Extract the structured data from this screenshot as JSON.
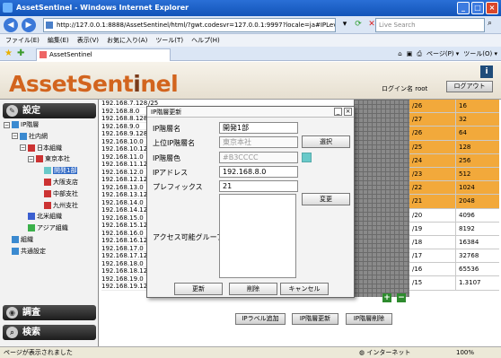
{
  "window": {
    "title": "AssetSentinel - Windows Internet Explorer",
    "btn_min": "_",
    "btn_max": "□",
    "btn_close": "×"
  },
  "browser": {
    "url": "http://127.0.0.1:8888/AssetSentinel/html/?gwt.codesvr=127.0.0.1:9997?locale=ja#IPLevel15",
    "search_placeholder": "Live Search",
    "menu": [
      "ファイル(E)",
      "編集(E)",
      "表示(V)",
      "お気に入り(A)",
      "ツール(T)",
      "ヘルプ(H)"
    ],
    "tab_label": "AssetSentinel",
    "toolbar_right": [
      "ページ(P) ▾",
      "ツール(O) ▾"
    ]
  },
  "app": {
    "logo_main": "AssetSent",
    "logo_i": "i",
    "logo_end": "nel",
    "login_label": "ログイン名 root",
    "logout_label": "ログアウト",
    "info_label": "i"
  },
  "sidebar": {
    "settings_label": "設定",
    "survey_label": "調査",
    "search_label": "検索",
    "tree": [
      {
        "label": "IP階層",
        "level": 0,
        "toggle": "⊟",
        "color": "#3b8ad0"
      },
      {
        "label": "社内網",
        "level": 1,
        "toggle": "⊟",
        "color": "#3b8ad0"
      },
      {
        "label": "日本組織",
        "level": 2,
        "toggle": "⊟",
        "color": "#cc3333"
      },
      {
        "label": "東京本社",
        "level": 3,
        "toggle": "⊟",
        "color": "#cc3333"
      },
      {
        "label": "開発1部",
        "level": 4,
        "toggle": "",
        "color": "#69c9c9",
        "selected": true
      },
      {
        "label": "大阪支店",
        "level": 4,
        "toggle": "",
        "color": "#cc3333"
      },
      {
        "label": "中部支社",
        "level": 4,
        "toggle": "",
        "color": "#cc3333"
      },
      {
        "label": "九州支社",
        "level": 4,
        "toggle": "",
        "color": "#cc3333"
      },
      {
        "label": "北米組織",
        "level": 2,
        "toggle": "",
        "color": "#3b5fd0"
      },
      {
        "label": "アジア組織",
        "level": 2,
        "toggle": "",
        "color": "#3bb04a"
      },
      {
        "label": "組織",
        "level": 0,
        "toggle": "",
        "color": "#3b8ad0"
      },
      {
        "label": "共通設定",
        "level": 0,
        "toggle": "",
        "color": "#3b8ad0"
      }
    ]
  },
  "iplist": [
    "192.168.7.128",
    "192.168.8.0",
    "192.168.8.128",
    "192.168.9.0",
    "192.168.9.128",
    "192.168.10.0",
    "192.168.10.128",
    "192.168.11.0",
    "192.168.11.128",
    "192.168.12.0",
    "192.168.12.128",
    "192.168.13.0",
    "192.168.13.128",
    "192.168.14.0",
    "192.168.14.128",
    "192.168.15.0",
    "192.168.15.128",
    "192.168.16.0",
    "192.168.16.128",
    "192.168.17.0",
    "192.168.17.128",
    "192.168.18.0",
    "192.168.18.128",
    "192.168.19.0",
    "192.168.19.128"
  ],
  "iplist_first_prefix": "/25",
  "sizes": [
    {
      "prefix": "/26",
      "count": "16",
      "highlight": true
    },
    {
      "prefix": "/27",
      "count": "32",
      "highlight": true
    },
    {
      "prefix": "/26",
      "count": "64",
      "highlight": true
    },
    {
      "prefix": "/25",
      "count": "128",
      "highlight": true
    },
    {
      "prefix": "/24",
      "count": "256",
      "highlight": true
    },
    {
      "prefix": "/23",
      "count": "512",
      "highlight": true
    },
    {
      "prefix": "/22",
      "count": "1024",
      "highlight": true
    },
    {
      "prefix": "/21",
      "count": "2048",
      "highlight": true
    },
    {
      "prefix": "/20",
      "count": "4096",
      "highlight": false
    },
    {
      "prefix": "/19",
      "count": "8192",
      "highlight": false
    },
    {
      "prefix": "/18",
      "count": "16384",
      "highlight": false
    },
    {
      "prefix": "/17",
      "count": "32768",
      "highlight": false
    },
    {
      "prefix": "/16",
      "count": "65536",
      "highlight": false
    },
    {
      "prefix": "/15",
      "count": "1.3107",
      "highlight": false
    }
  ],
  "actions": {
    "add_label": "IPラベル追加",
    "update_label": "IP階層更新",
    "delete_label": "IP階層削除",
    "plus": "+",
    "minus": "−"
  },
  "dialog": {
    "title": "IP階層更新",
    "name_label": "IP階層名",
    "name_value": "開発1部",
    "parent_label": "上位IP階層名",
    "parent_value": "東京本社",
    "select_label": "選択",
    "color_label": "IP階層色",
    "color_value": "#B3CCCC",
    "address_label": "IPアドレス",
    "address_value": "192.168.8.0",
    "prefix_label": "プレフィックス",
    "prefix_value": "21",
    "change_label": "変更",
    "access_label": "アクセス可能グループ",
    "update_label": "更新",
    "delete_label": "削除",
    "cancel_label": "キャンセル",
    "swatch_color": "#69C9C9"
  },
  "status": {
    "text": "ページが表示されました",
    "zone": "インターネット",
    "zoom": "100%"
  }
}
